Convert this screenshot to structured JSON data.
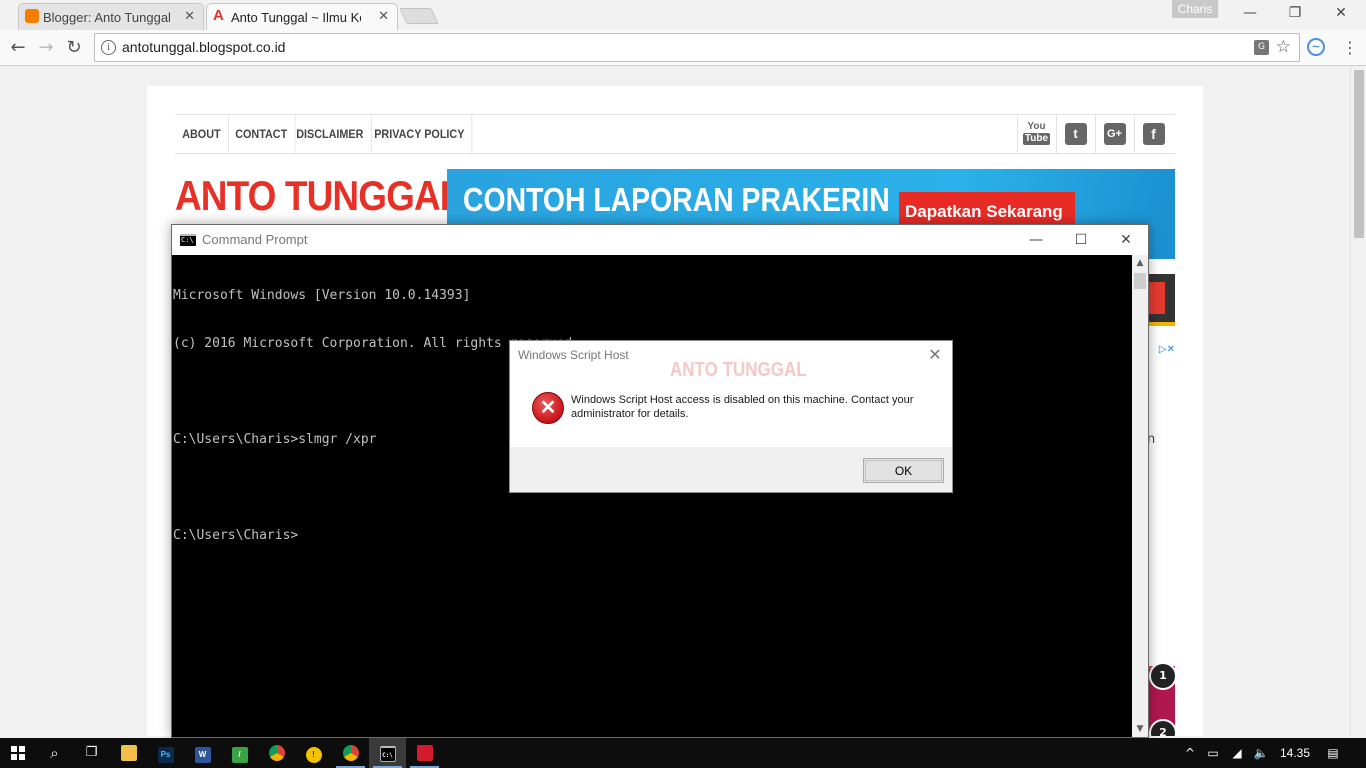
{
  "browser": {
    "tabs": [
      {
        "title": "Blogger: Anto Tunggal -",
        "favicon": "blogger-icon",
        "color": "#f57d00"
      },
      {
        "title": "Anto Tunggal ~ Ilmu Kor",
        "favicon": "site-a-icon",
        "color": "#e73127"
      }
    ],
    "profile_name": "Charis",
    "url": "antotunggal.blogspot.co.id"
  },
  "site": {
    "nav": [
      "ABOUT",
      "CONTACT",
      "DISCLAIMER",
      "PRIVACY POLICY"
    ],
    "social_icons": [
      "youtube-icon",
      "twitter-icon",
      "google-plus-icon",
      "facebook-icon"
    ],
    "logo": "ANTO TUNGGAL",
    "banner_title": "CONTOH LAPORAN PRAKERIN",
    "banner_cta": "Dapatkan Sekarang",
    "side_letter": "n",
    "ranks": [
      "1",
      "2"
    ]
  },
  "cmd": {
    "title": "Command Prompt",
    "lines": [
      "Microsoft Windows [Version 10.0.14393]",
      "(c) 2016 Microsoft Corporation. All rights reserved.",
      "",
      "C:\\Users\\Charis>slmgr /xpr",
      "",
      "C:\\Users\\Charis>"
    ]
  },
  "dialog": {
    "title": "Windows Script Host",
    "watermark": "ANTO TUNGGAL",
    "message": "Windows Script Host access is disabled on this machine. Contact your administrator for details.",
    "ok_label": "OK",
    "icon": "error-icon"
  },
  "taskbar": {
    "clock": "14.35"
  },
  "colors": {
    "brand_red": "#e73127",
    "banner_blue": "#2ab1ea",
    "taskbar": "#0d0d0d"
  }
}
